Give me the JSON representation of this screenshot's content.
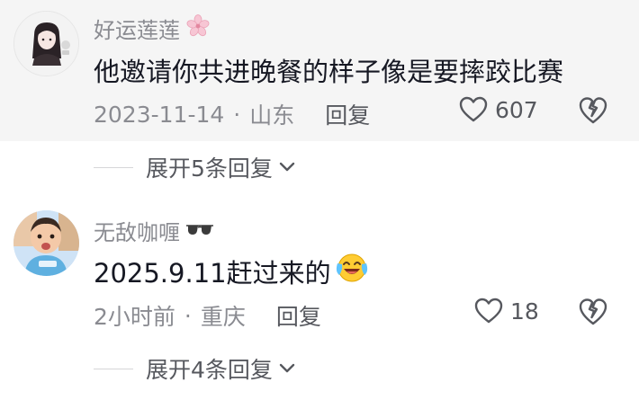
{
  "comments": [
    {
      "username": "好运莲莲",
      "username_badge": "cherry-blossom-icon",
      "text": "他邀请你共进晚餐的样子像是要摔跤比赛",
      "date": "2023-11-14",
      "location": "山东",
      "reply_label": "回复",
      "like_count": "607",
      "expand_label": "展开5条回复"
    },
    {
      "username": "无敌咖喱",
      "username_badge": "sunglasses-icon",
      "text": "2025.9.11赶过来的",
      "text_emoji": "laughing-crying-face-icon",
      "date": "2小时前",
      "location": "重庆",
      "reply_label": "回复",
      "like_count": "18",
      "expand_label": "展开4条回复"
    }
  ],
  "meta_separator": "·",
  "colors": {
    "secondary_text": "#8a8b91",
    "primary_text": "#161823",
    "highlight_bg": "#f5f5f5"
  }
}
